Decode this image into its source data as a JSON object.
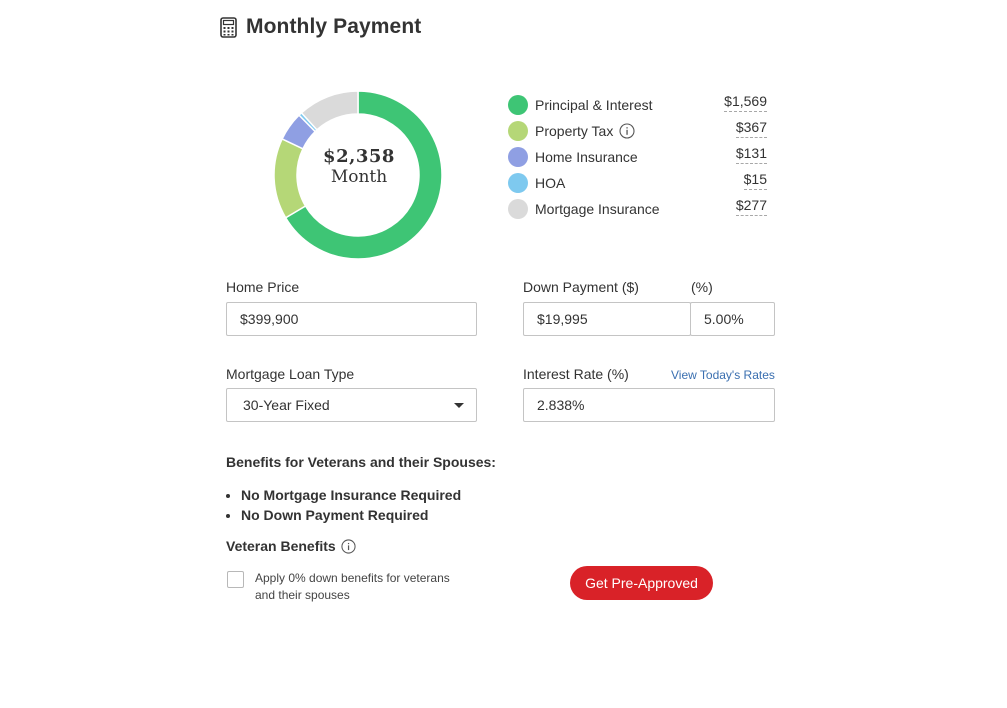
{
  "header": {
    "title": "Monthly Payment",
    "icon": "calculator-icon"
  },
  "summary": {
    "amount": "$2,358",
    "unit": "Month"
  },
  "colors": {
    "principal_interest": "#3ec575",
    "property_tax": "#b5d777",
    "home_insurance": "#8f9fe3",
    "hoa": "#7ec9ef",
    "mortgage_insurance": "#dadada",
    "accent_red": "#d92228",
    "link_blue": "#3a6fb0"
  },
  "breakdown": [
    {
      "label": "Principal & Interest",
      "value": "$1,569",
      "amount": 1569,
      "color": "#3ec575",
      "info": false
    },
    {
      "label": "Property Tax",
      "value": "$367",
      "amount": 367,
      "color": "#b5d777",
      "info": true
    },
    {
      "label": "Home Insurance",
      "value": "$131",
      "amount": 131,
      "color": "#8f9fe3",
      "info": false
    },
    {
      "label": "HOA",
      "value": "$15",
      "amount": 15,
      "color": "#7ec9ef",
      "info": false
    },
    {
      "label": "Mortgage Insurance",
      "value": "$277",
      "amount": 277,
      "color": "#dadada",
      "info": false
    }
  ],
  "form": {
    "home_price": {
      "label": "Home Price",
      "value": "$399,900"
    },
    "down_payment": {
      "label": "Down Payment ($)",
      "value": "$19,995",
      "percent_label": "(%)",
      "percent_value": "5.00%"
    },
    "loan_type": {
      "label": "Mortgage Loan Type",
      "value": "30-Year Fixed"
    },
    "interest_rate": {
      "label": "Interest Rate (%)",
      "value": "2.838%",
      "link": "View Today's Rates"
    }
  },
  "benefits": {
    "heading": "Benefits for Veterans and their Spouses:",
    "items": [
      "No Mortgage Insurance Required",
      "No Down Payment Required"
    ],
    "section_label": "Veteran Benefits",
    "checkbox_text_line1": "Apply 0% down benefits for veterans",
    "checkbox_text_line2": "and their spouses",
    "checkbox_checked": false
  },
  "cta": {
    "label": "Get Pre-Approved"
  }
}
